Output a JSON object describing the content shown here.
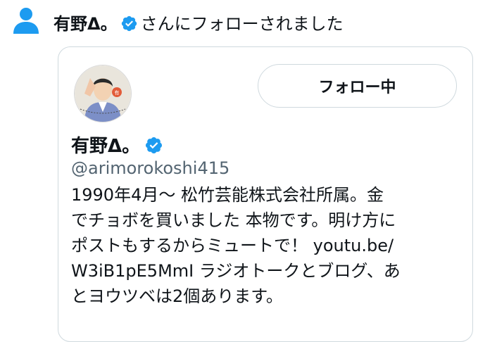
{
  "notification": {
    "user_name": "有野Δ。",
    "action_text": "さんにフォローされました",
    "icon": "person-icon"
  },
  "card": {
    "avatar_icon": "profile-avatar",
    "follow_button_label": "フォロー中",
    "display_name": "有野Δ。",
    "verified_icon": "verified-badge-icon",
    "handle": "@arimorokoshi415",
    "bio_lines": [
      "1990年4月～ 松竹芸能株式会社所属。金",
      "でチョボを買いました 本物です。明け方に",
      "ポストもするからミュートで！ youtu.be/",
      "W3iB1pE5MmI ラジオトークとブログ、あ",
      "とヨウツベは2個あります。"
    ]
  },
  "colors": {
    "accent": "#1d9bf0",
    "text": "#0f1419",
    "secondary_text": "#536471",
    "border": "#cfd9de"
  }
}
